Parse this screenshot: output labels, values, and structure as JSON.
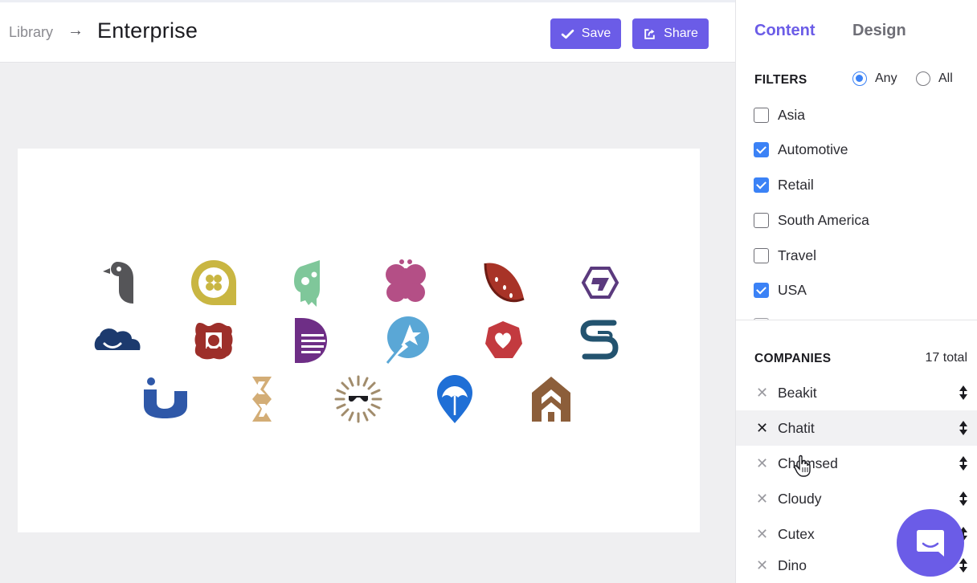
{
  "breadcrumb": {
    "root": "Library",
    "separator": "→",
    "title": "Enterprise"
  },
  "toolbar": {
    "save_label": "Save",
    "share_label": "Share"
  },
  "panel": {
    "tabs": [
      {
        "label": "Content",
        "active": true
      },
      {
        "label": "Design",
        "active": false
      }
    ],
    "filters": {
      "title": "FILTERS",
      "match_any": "Any",
      "match_all": "All",
      "match_selected": "Any",
      "items": [
        {
          "label": "Asia",
          "checked": false
        },
        {
          "label": "Automotive",
          "checked": true
        },
        {
          "label": "Retail",
          "checked": true
        },
        {
          "label": "South America",
          "checked": false
        },
        {
          "label": "Travel",
          "checked": false
        },
        {
          "label": "USA",
          "checked": true
        }
      ]
    },
    "companies": {
      "title": "COMPANIES",
      "count": "17 total",
      "items": [
        "Beakit",
        "Chatit",
        "Chomsed",
        "Cloudy",
        "Cutex",
        "Dino"
      ]
    }
  },
  "canvas": {
    "logos": [
      "bird-logo",
      "speech-flower-logo",
      "skull-logo",
      "butterfly-logo",
      "watermelon-logo",
      "hexagon-logo",
      "cloud-logo",
      "flower-square-logo",
      "striped-d-logo",
      "star-comet-logo",
      "heart-circle-logo",
      "linked-s-logo",
      "u-shape-logo",
      "knot-logo",
      "sun-glasses-logo",
      "umbrella-pin-logo",
      "house-logo"
    ]
  },
  "colors": {
    "accent": "#6b5ce7",
    "checkbox": "#3b82f6"
  },
  "icons": {
    "save": "check-icon",
    "share": "share-icon",
    "remove": "close-icon",
    "drag": "sort-icon",
    "chat": "chat-icon"
  }
}
